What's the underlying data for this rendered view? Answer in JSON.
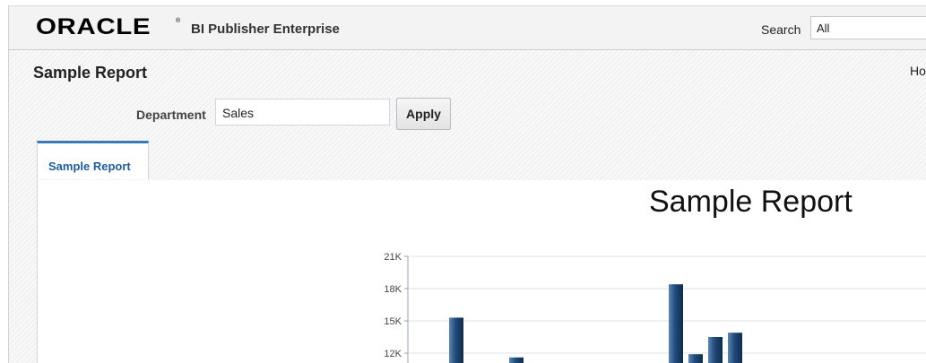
{
  "header": {
    "logo_text": "ORACLE",
    "logo_reg": "®",
    "product_name": "BI Publisher Enterprise",
    "search_label": "Search",
    "search_scope": "All"
  },
  "page": {
    "title": "Sample Report",
    "home_link": "Ho"
  },
  "filters": {
    "department_label": "Department",
    "department_value": "Sales",
    "apply_label": "Apply"
  },
  "tabs": [
    {
      "label": "Sample Report",
      "active": true
    }
  ],
  "colors": {
    "bar": "#1f4a7a",
    "tab_accent": "#3b79bd",
    "grid": "#dde3ea"
  },
  "chart_data": {
    "type": "bar",
    "title": "Sample Report",
    "ylim": [
      0,
      21000
    ],
    "y_ticks": [
      {
        "value": 21000,
        "label": "21K"
      },
      {
        "value": 18000,
        "label": "18K"
      },
      {
        "value": 15000,
        "label": "15K"
      },
      {
        "value": 12000,
        "label": "12K"
      }
    ],
    "grid": true,
    "values": [
      15300,
      11600,
      18400,
      11900,
      13500,
      13900
    ]
  }
}
